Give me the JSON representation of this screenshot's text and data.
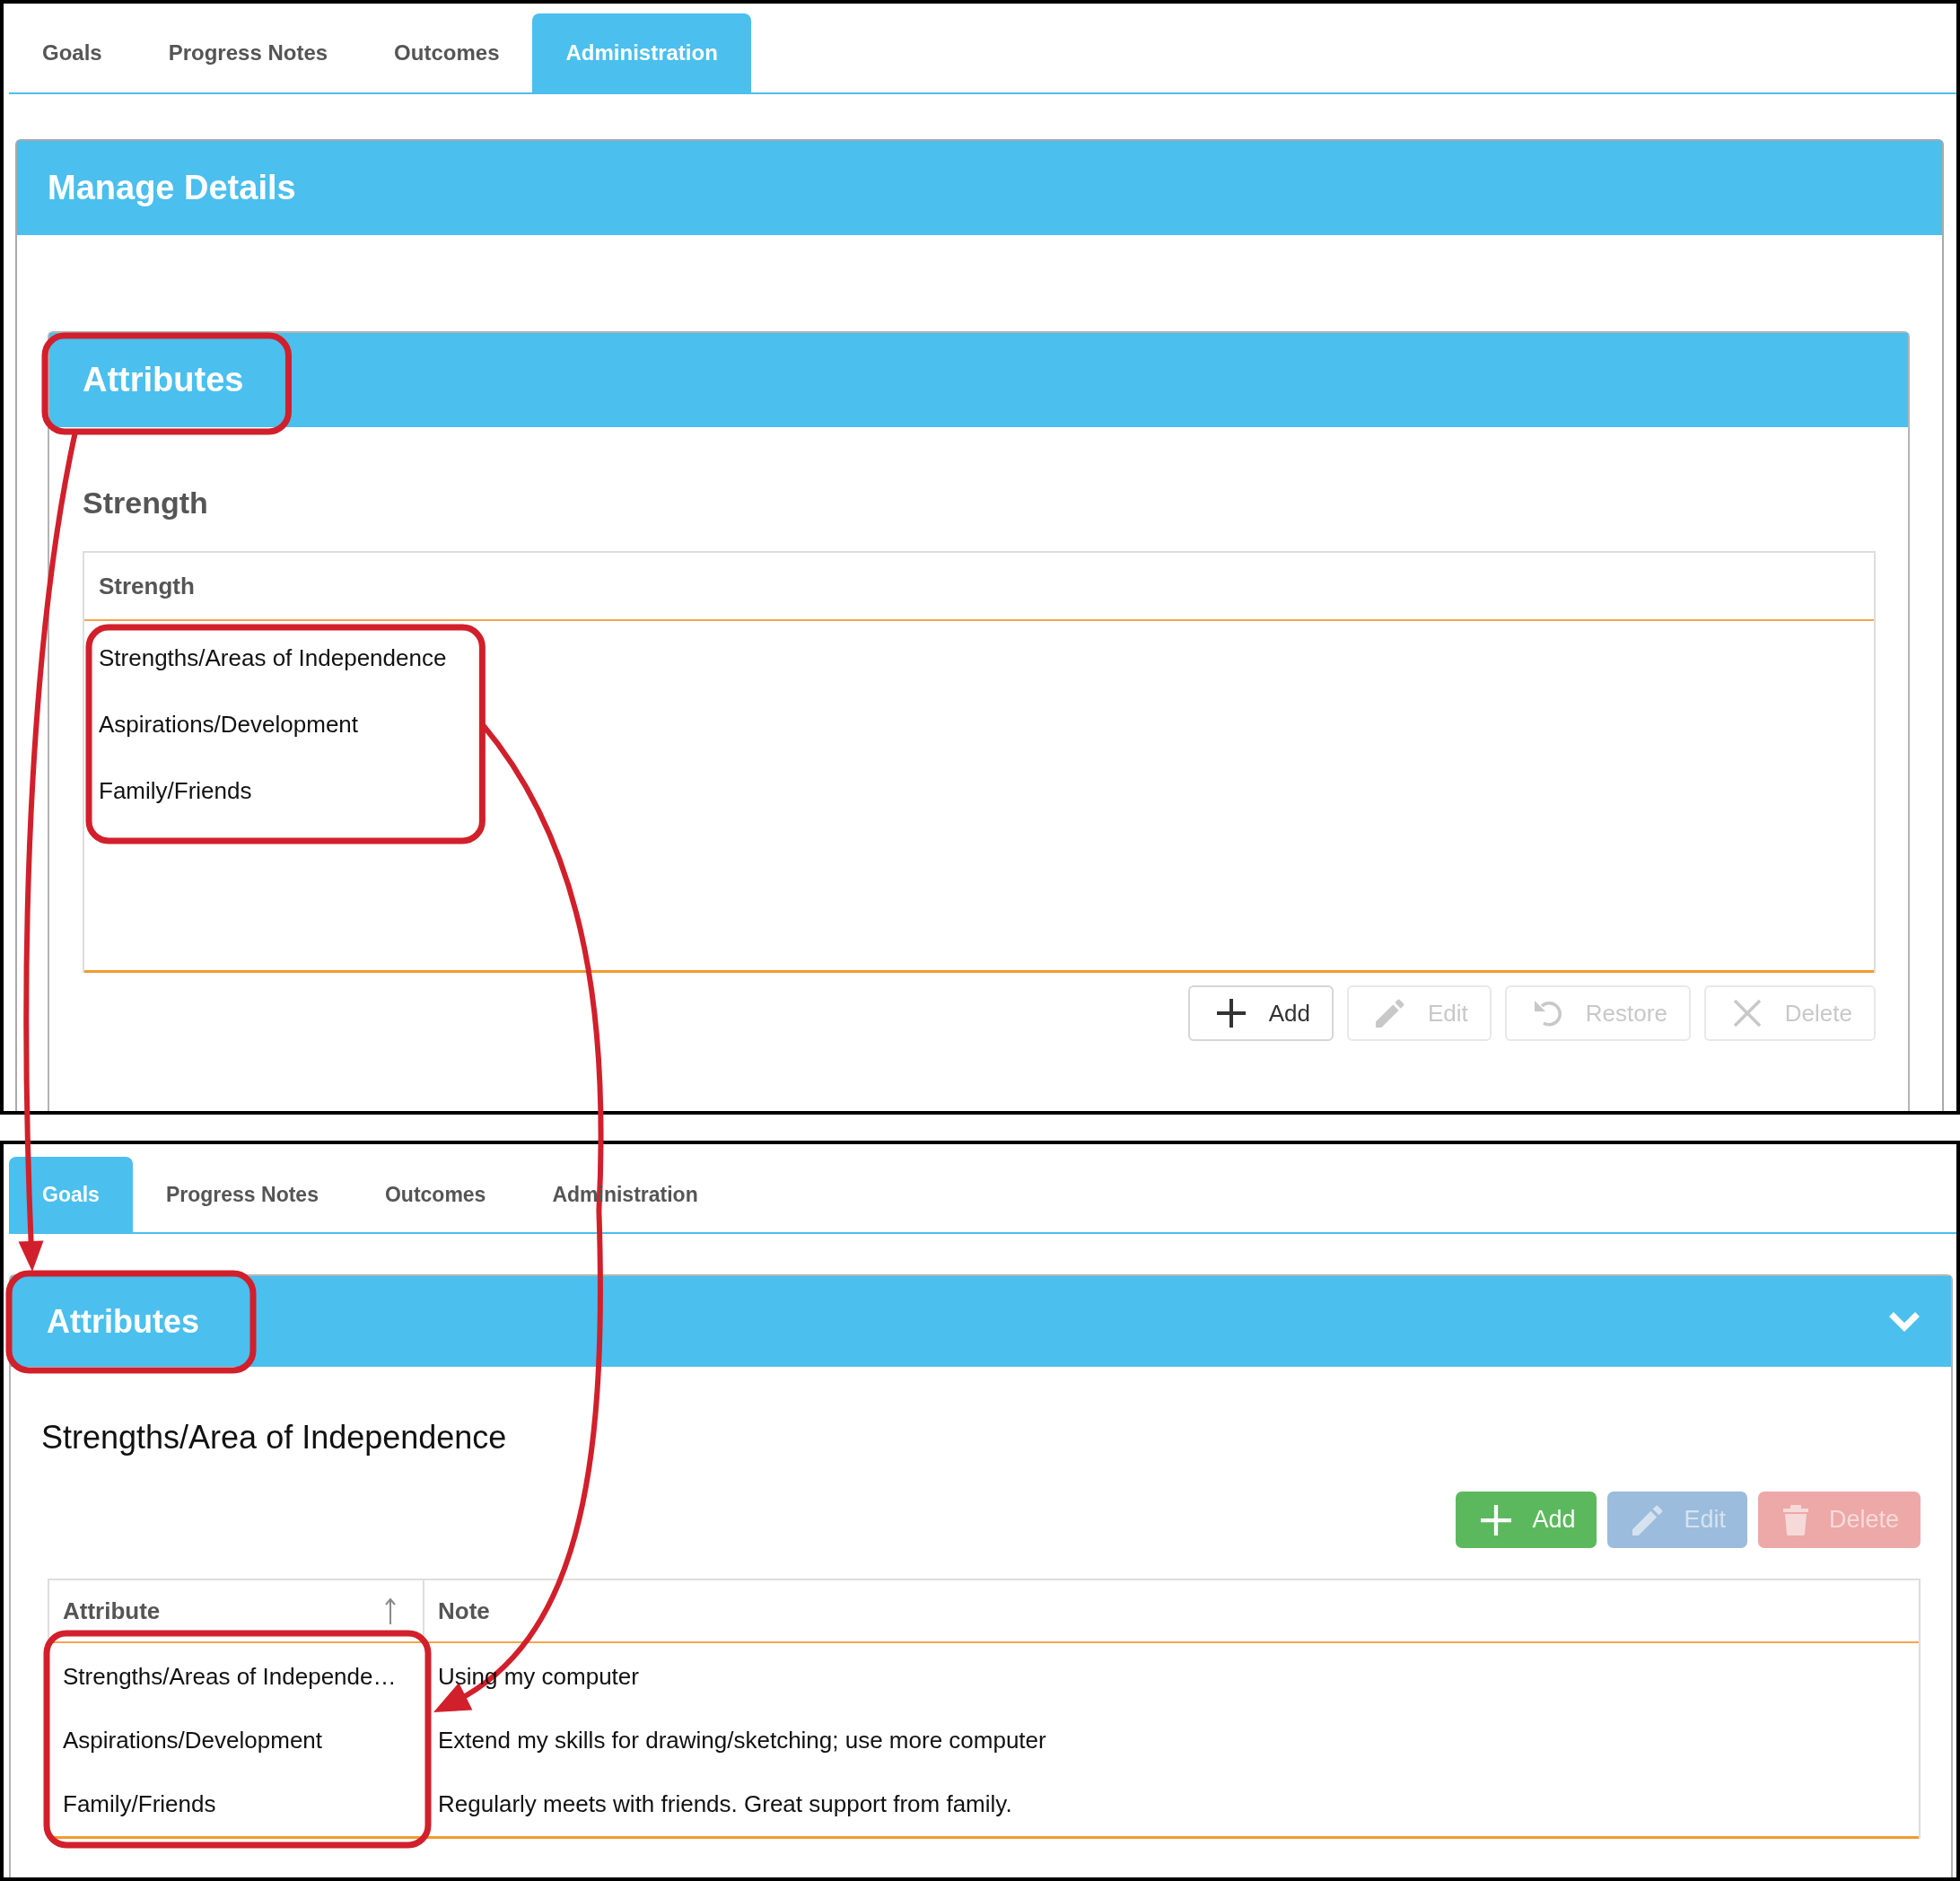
{
  "screens": [
    {
      "tabs": [
        {
          "label": "Goals",
          "selected": false
        },
        {
          "label": "Progress Notes",
          "selected": false
        },
        {
          "label": "Outcomes",
          "selected": false
        },
        {
          "label": "Administration",
          "selected": true
        }
      ],
      "panel": {
        "title": "Manage Details",
        "section": {
          "title": "Attributes",
          "heading": "Strength",
          "table": {
            "columns": [
              {
                "label": "Strength"
              }
            ],
            "rows": [
              [
                "Strengths/Areas of Independence"
              ],
              [
                "Aspirations/Development"
              ],
              [
                "Family/Friends"
              ]
            ]
          },
          "toolbar": {
            "kind": "outline",
            "buttons": [
              {
                "kind": "add",
                "label": "Add",
                "disabled": false
              },
              {
                "kind": "edit",
                "label": "Edit",
                "disabled": true
              },
              {
                "kind": "restore",
                "label": "Restore",
                "disabled": true
              },
              {
                "kind": "delete",
                "label": "Delete",
                "disabled": true
              }
            ]
          }
        }
      }
    },
    {
      "tabs": [
        {
          "label": "Goals",
          "selected": true
        },
        {
          "label": "Progress Notes",
          "selected": false
        },
        {
          "label": "Outcomes",
          "selected": false
        },
        {
          "label": "Administration",
          "selected": false
        }
      ],
      "section": {
        "title": "Attributes",
        "expanded": true,
        "heading": "Strengths/Area of Independence",
        "toolbar": {
          "kind": "solid",
          "buttons": [
            {
              "kind": "add",
              "label": "Add",
              "disabled": false
            },
            {
              "kind": "edit",
              "label": "Edit",
              "disabled": true
            },
            {
              "kind": "delete",
              "label": "Delete",
              "disabled": true
            }
          ]
        },
        "table": {
          "columns": [
            {
              "label": "Attribute",
              "sorted": true
            },
            {
              "label": "Note",
              "sorted": false
            }
          ],
          "rows": [
            [
              "Strengths/Areas of Independe…",
              "Using my computer"
            ],
            [
              "Aspirations/Development",
              "Extend my skills for drawing/sketching; use more computer"
            ],
            [
              "Family/Friends",
              "Regularly meets with friends. Great support from family."
            ]
          ]
        }
      }
    }
  ]
}
